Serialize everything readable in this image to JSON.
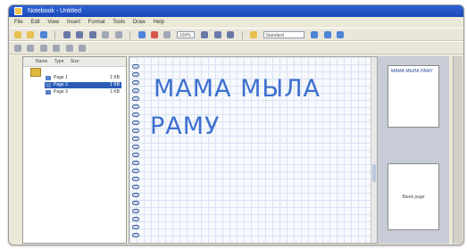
{
  "window": {
    "title": "Notebook - Untitled"
  },
  "menu": [
    "File",
    "Edit",
    "View",
    "Insert",
    "Format",
    "Tools",
    "Draw",
    "Help"
  ],
  "toolbar": {
    "font_size": "100%",
    "pen_style": "Standard"
  },
  "tree": {
    "headers": [
      "Name",
      "Type",
      "Size"
    ],
    "rows": [
      {
        "name": "Page 1",
        "size": "1 KB"
      },
      {
        "name": "Page 2",
        "size": "1 KB"
      },
      {
        "name": "Page 3",
        "size": "1 KB"
      }
    ]
  },
  "canvas": {
    "line1": "МАМА МЫЛА",
    "line2": "РАМУ"
  },
  "thumbnails": [
    {
      "caption": "МАМА МЫЛА РАМУ"
    },
    {
      "caption": "Blank page"
    }
  ],
  "colors": {
    "ink": "#3d6fd0",
    "titlebar": "#1a48b8",
    "selection": "#2a5cb8"
  }
}
